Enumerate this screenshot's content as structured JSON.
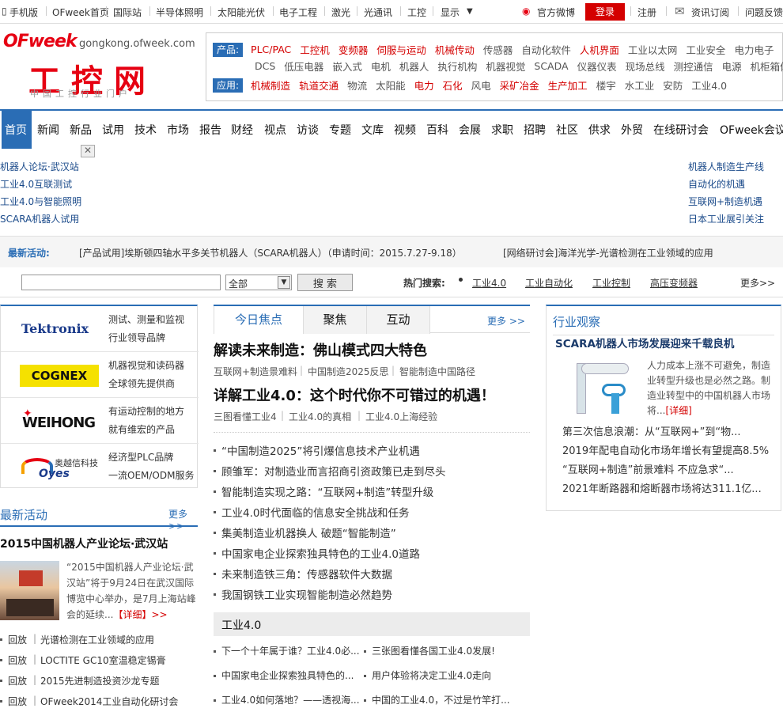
{
  "topbar": {
    "items": [
      "手机版",
      "OFweek首页",
      "国际站",
      "半导体照明",
      "太阳能光伏",
      "电子工程",
      "激光",
      "光通讯",
      "工控",
      "显示"
    ],
    "weibo": "官方微博",
    "login": "登录",
    "register": "注册",
    "subscribe": "资讯订阅",
    "feedback": "问题反馈"
  },
  "header": {
    "logo_brand": "OFweek",
    "logo_domain": "gongkong.ofweek.com",
    "logo_title": "工控网",
    "logo_subtitle": "中国工控行业门户",
    "product_tag": "产品:",
    "products_row1": [
      {
        "t": "PLC/PAC",
        "red": true
      },
      {
        "t": "工控机",
        "red": true
      },
      {
        "t": "变频器",
        "red": true
      },
      {
        "t": "伺服与运动",
        "red": true
      },
      {
        "t": "机械传动",
        "red": true
      },
      {
        "t": "传感器",
        "red": false
      },
      {
        "t": "自动化软件",
        "red": false
      },
      {
        "t": "人机界面",
        "red": true
      },
      {
        "t": "工业以太网",
        "red": false
      },
      {
        "t": "工业安全",
        "red": false
      },
      {
        "t": "电力电子",
        "red": false
      }
    ],
    "products_row2": [
      "DCS",
      "低压电器",
      "嵌入式",
      "电机",
      "机器人",
      "执行机构",
      "机器视觉",
      "SCADA",
      "仪器仪表",
      "现场总线",
      "测控通信",
      "电源",
      "机柜箱体"
    ],
    "app_tag": "应用:",
    "apps": [
      {
        "t": "机械制造",
        "red": true
      },
      {
        "t": "轨道交通",
        "red": true
      },
      {
        "t": "物流",
        "red": false
      },
      {
        "t": "太阳能",
        "red": false
      },
      {
        "t": "电力",
        "red": true
      },
      {
        "t": "石化",
        "red": true
      },
      {
        "t": "风电",
        "red": false
      },
      {
        "t": "采矿冶金",
        "red": true
      },
      {
        "t": "生产加工",
        "red": true
      },
      {
        "t": "楼宇",
        "red": false
      },
      {
        "t": "水工业",
        "red": false
      },
      {
        "t": "安防",
        "red": false
      },
      {
        "t": "工业4.0",
        "red": false
      }
    ]
  },
  "nav": [
    "首页",
    "新闻",
    "新品",
    "试用",
    "技术",
    "市场",
    "报告",
    "财经",
    "视点",
    "访谈",
    "专题",
    "文库",
    "视频",
    "百科",
    "会展",
    "求职",
    "招聘",
    "社区",
    "供求",
    "外贸",
    "在线研讨会",
    "OFweek会议"
  ],
  "float_left": [
    "机器人论坛·武汉站",
    "工业4.0互联测试",
    "工业4.0与智能照明",
    "SCARA机器人试用"
  ],
  "float_right": [
    "机器人制造生产线",
    "自动化的机遇",
    "互联网+制造机遇",
    "日本工业展引关注"
  ],
  "activity": {
    "label": "最新活动:",
    "item1": "[产品试用]埃斯顿四轴水平多关节机器人（SCARA机器人）（申请时间：2015.7.27-9.18）",
    "item2": "[网络研讨会]海洋光学-光谱检测在工业领域的应用"
  },
  "search": {
    "select": "全部",
    "button": "搜 索",
    "hot_label": "热门搜索:",
    "hot": [
      "工业4.0",
      "工业自动化",
      "工业控制",
      "高压变频器"
    ],
    "more": "更多>>"
  },
  "brands": [
    {
      "logo": "Tektronix",
      "l1": "测试、测量和监视",
      "l2": "行业领导品牌"
    },
    {
      "logo": "COGNEX",
      "l1": "机器视觉和读码器",
      "l2": "全球领先提供商"
    },
    {
      "logo": "WEIHONG",
      "l1": "有运动控制的地方",
      "l2": "就有维宏的产品"
    },
    {
      "logo": "Oyes",
      "l1": "经济型PLC品牌",
      "l2": "一流OEM/ODM服务",
      "cn": "奥越信科技"
    }
  ],
  "latest": {
    "title": "最新活动",
    "more": "更多>>",
    "headline": "2015中国机器人产业论坛·武汉站",
    "desc": "“2015中国机器人产业论坛·武汉站”将于9月24日在武汉国际博览中心举办，是7月上海站峰会的延续...",
    "detail": "【详细】>>",
    "items": [
      {
        "tag": "回放",
        "t": "光谱检测在工业领域的应用"
      },
      {
        "tag": "回放",
        "t": "LOCTITE GC10室温稳定锡膏"
      },
      {
        "tag": "回放",
        "t": "2015先进制造投资沙龙专题"
      },
      {
        "tag": "回放",
        "t": "OFweek2014工业自动化研讨会"
      }
    ]
  },
  "focus": {
    "tabs": [
      "今日焦点",
      "聚焦",
      "互动"
    ],
    "more": "更多 >>",
    "h1": "解读未来制造：佛山模式四大特色",
    "h1_subs": [
      "互联网+制造景难料",
      "中国制造2025反思",
      "智能制造中国路径"
    ],
    "h2": "详解工业4.0：这个时代你不可错过的机遇！",
    "h2_subs": [
      "三图看懂工业4",
      "工业4.0的真相",
      "工业4.0上海经验"
    ],
    "list": [
      "“中国制造2025”将引爆信息技术产业机遇",
      "顾雏军：对制造业而言招商引资政策已走到尽头",
      "智能制造实现之路：“互联网+制造”转型升级",
      "工业4.0时代面临的信息安全挑战和任务",
      "集美制造业机器换人 破题“智能制造”",
      "中国家电企业探索独具特色的工业4.0道路",
      "未来制造铁三角：传感器软件大数据",
      "我国钢铁工业实现智能制造必然趋势"
    ],
    "sub_title": "工业4.0",
    "sub_list": [
      [
        "下一个十年属于谁？工业4.0必...",
        "三张图看懂各国工业4.0发展!"
      ],
      [
        "中国家电企业探索独具特色的...",
        "用户体验将决定工业4.0走向"
      ],
      [
        "工业4.0如何落地？——透视海...",
        "中国的工业4.0，不过是竹竿打..."
      ]
    ]
  },
  "industry": {
    "title": "行业观察",
    "headline": "SCARA机器人市场发展迎来千载良机",
    "desc": "人力成本上涨不可避免，制造业转型升级也是必然之路。制造业转型中的中国机器人市场将...",
    "detail": "[详细]",
    "list": [
      "第三次信息浪潮：从“互联网+”到“物...",
      "2019年配电自动化市场年增长有望提高8.5%",
      "“互联网+制造”前景难料 不应急求“...",
      "2021年断路器和熔断器市场将达311.1亿..."
    ]
  }
}
